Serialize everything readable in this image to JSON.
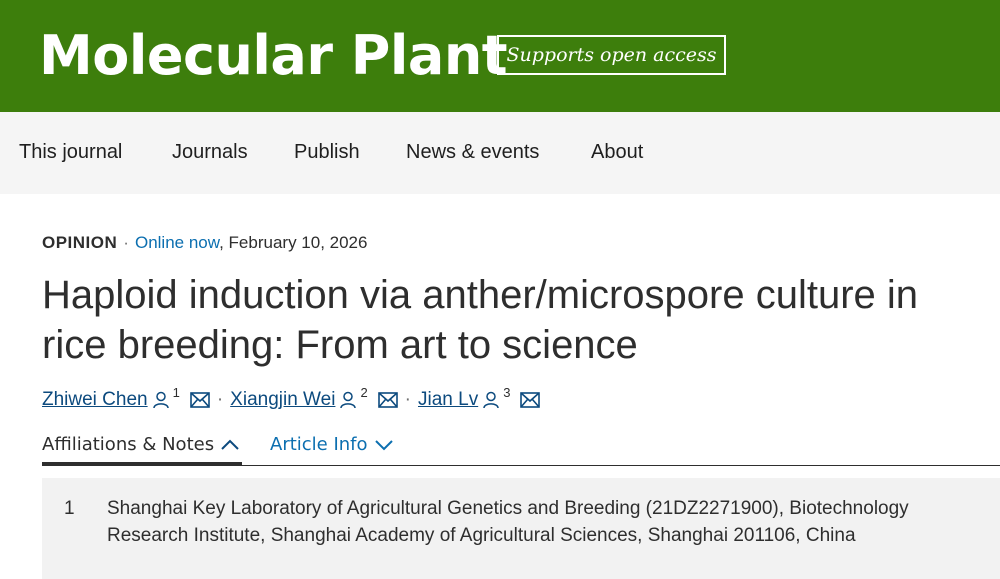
{
  "masthead": {
    "journal_title": "Molecular Plant",
    "badge_text": "Supports open access",
    "background_color": "#3d7e0c"
  },
  "nav": {
    "items": [
      "This journal",
      "Journals",
      "Publish",
      "News & events",
      "About"
    ]
  },
  "article": {
    "type": "OPINION",
    "separator": "·",
    "status_link": "Online now",
    "date": ", February 10, 2026",
    "title_line1": "Haploid induction via anther/microspore culture in",
    "title_line2": "rice breeding: From art to science",
    "authors": [
      {
        "name": "Zhiwei Chen",
        "affiliation": "1",
        "icons": [
          "person-icon",
          "mail-icon"
        ]
      },
      {
        "name": "Xiangjin Wei",
        "affiliation": "2",
        "icons": [
          "person-icon",
          "mail-icon"
        ]
      },
      {
        "name": "Jian Lv",
        "affiliation": "3",
        "icons": [
          "person-icon",
          "mail-icon"
        ]
      }
    ],
    "author_separator": "·"
  },
  "tabs": {
    "affiliations_label": "Affiliations & Notes",
    "article_info_label": "Article Info"
  },
  "affiliations": [
    {
      "number": "1",
      "text": "Shanghai Key Laboratory of Agricultural Genetics and Breeding (21DZ2271900), Biotechnology Research Institute, Shanghai Academy of Agricultural Sciences, Shanghai 201106, China"
    }
  ],
  "colors": {
    "link": "#0c6fb0",
    "author_link": "#0c4a7e",
    "text": "#2e2e2e",
    "nav_bg": "#f5f5f5",
    "panel_bg": "#f2f2f2"
  }
}
